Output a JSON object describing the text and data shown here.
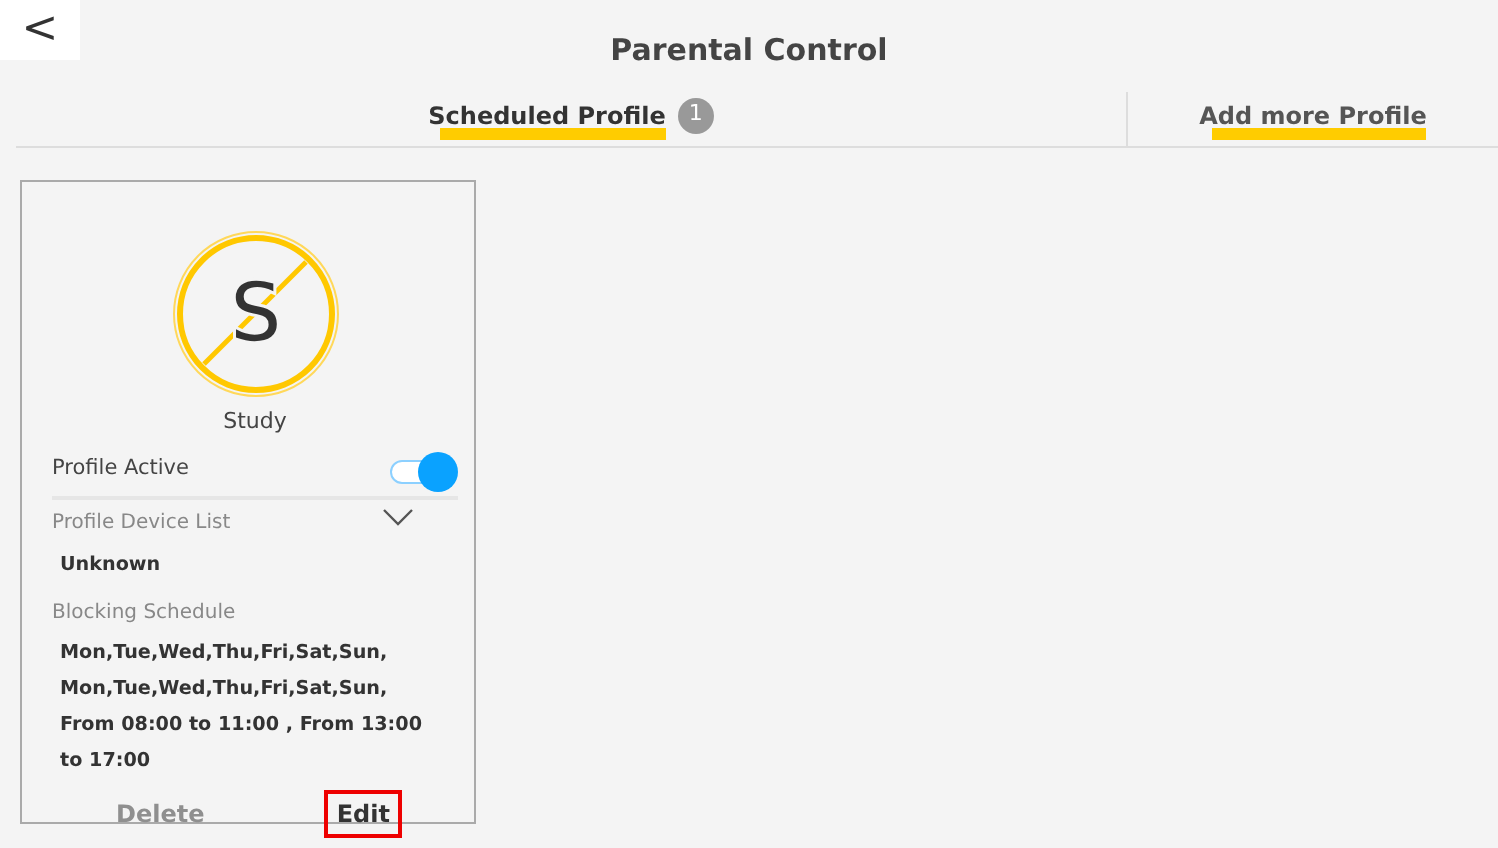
{
  "back_button": {
    "label": "<"
  },
  "title": "Parental Control",
  "tabs": [
    {
      "label": "Scheduled Profile",
      "count": "1",
      "selected": true
    },
    {
      "label": "Add more Profile",
      "selected": false
    }
  ],
  "profiles": [
    {
      "initial": "S",
      "name": "Study",
      "active_label": "Profile Active",
      "active": true,
      "device_list_label": "Profile Device List",
      "expanded": false,
      "device": "Unknown",
      "schedule_label": "Blocking Schedule",
      "schedule": "Mon,Tue,Wed,Thu,Fri,Sat,Sun, Mon,Tue,Wed,Thu,Fri,Sat,Sun, From 08:00 to 11:00 , From 13:00 to 17:00",
      "buttons": [
        {
          "label": "Delete",
          "disabled": true
        },
        {
          "label": "Edit",
          "disabled": false
        }
      ]
    }
  ]
}
